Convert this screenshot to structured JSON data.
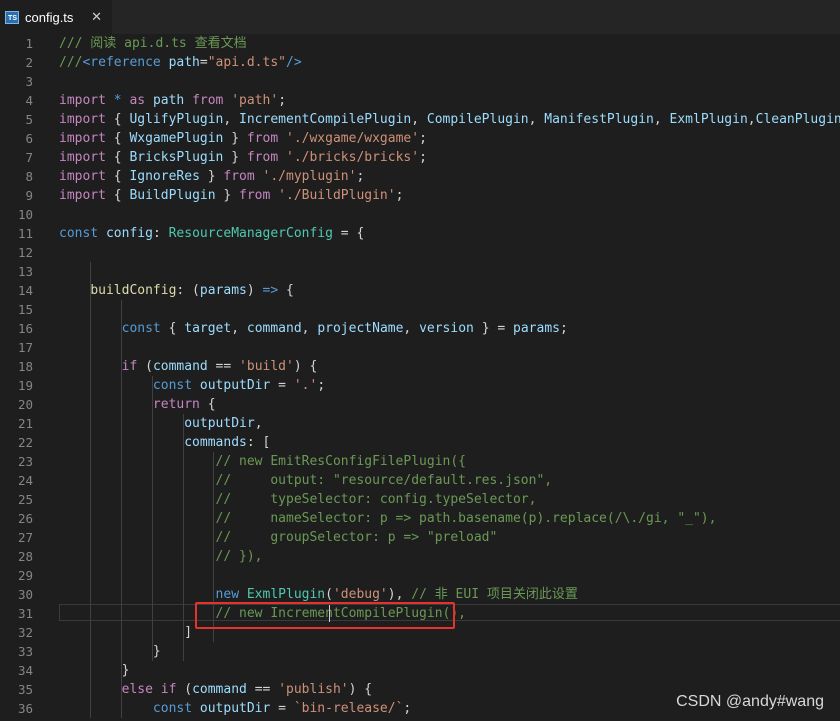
{
  "tab": {
    "filename": "config.ts",
    "icon": "ts-file-icon",
    "close_label": "✕"
  },
  "editor": {
    "lines": [
      {
        "n": "1",
        "tokens": [
          {
            "c": "cm",
            "t": "/// 阅读 api.d.ts 查看文档"
          }
        ]
      },
      {
        "n": "2",
        "tokens": [
          {
            "c": "cm",
            "t": "///"
          },
          {
            "c": "kw",
            "t": "<reference "
          },
          {
            "c": "var",
            "t": "path"
          },
          {
            "c": "pl",
            "t": "="
          },
          {
            "c": "str",
            "t": "\"api.d.ts\""
          },
          {
            "c": "kw",
            "t": "/>"
          }
        ]
      },
      {
        "n": "3",
        "tokens": []
      },
      {
        "n": "4",
        "tokens": [
          {
            "c": "ctl",
            "t": "import"
          },
          {
            "c": "pl",
            "t": " "
          },
          {
            "c": "kw",
            "t": "*"
          },
          {
            "c": "pl",
            "t": " "
          },
          {
            "c": "ctl",
            "t": "as"
          },
          {
            "c": "pl",
            "t": " "
          },
          {
            "c": "var",
            "t": "path"
          },
          {
            "c": "pl",
            "t": " "
          },
          {
            "c": "ctl",
            "t": "from"
          },
          {
            "c": "pl",
            "t": " "
          },
          {
            "c": "str",
            "t": "'path'"
          },
          {
            "c": "pl",
            "t": ";"
          }
        ]
      },
      {
        "n": "5",
        "tokens": [
          {
            "c": "ctl",
            "t": "import"
          },
          {
            "c": "pl",
            "t": " { "
          },
          {
            "c": "var",
            "t": "UglifyPlugin"
          },
          {
            "c": "pl",
            "t": ", "
          },
          {
            "c": "var",
            "t": "IncrementCompilePlugin"
          },
          {
            "c": "pl",
            "t": ", "
          },
          {
            "c": "var",
            "t": "CompilePlugin"
          },
          {
            "c": "pl",
            "t": ", "
          },
          {
            "c": "var",
            "t": "ManifestPlugin"
          },
          {
            "c": "pl",
            "t": ", "
          },
          {
            "c": "var",
            "t": "ExmlPlugin"
          },
          {
            "c": "pl",
            "t": ","
          },
          {
            "c": "var",
            "t": "CleanPlugin"
          },
          {
            "c": "pl",
            "t": ","
          }
        ]
      },
      {
        "n": "6",
        "tokens": [
          {
            "c": "ctl",
            "t": "import"
          },
          {
            "c": "pl",
            "t": " { "
          },
          {
            "c": "var",
            "t": "WxgamePlugin"
          },
          {
            "c": "pl",
            "t": " } "
          },
          {
            "c": "ctl",
            "t": "from"
          },
          {
            "c": "pl",
            "t": " "
          },
          {
            "c": "str",
            "t": "'./wxgame/wxgame'"
          },
          {
            "c": "pl",
            "t": ";"
          }
        ]
      },
      {
        "n": "7",
        "tokens": [
          {
            "c": "ctl",
            "t": "import"
          },
          {
            "c": "pl",
            "t": " { "
          },
          {
            "c": "var",
            "t": "BricksPlugin"
          },
          {
            "c": "pl",
            "t": " } "
          },
          {
            "c": "ctl",
            "t": "from"
          },
          {
            "c": "pl",
            "t": " "
          },
          {
            "c": "str",
            "t": "'./bricks/bricks'"
          },
          {
            "c": "pl",
            "t": ";"
          }
        ]
      },
      {
        "n": "8",
        "tokens": [
          {
            "c": "ctl",
            "t": "import"
          },
          {
            "c": "pl",
            "t": " { "
          },
          {
            "c": "var",
            "t": "IgnoreRes"
          },
          {
            "c": "pl",
            "t": " } "
          },
          {
            "c": "ctl",
            "t": "from"
          },
          {
            "c": "pl",
            "t": " "
          },
          {
            "c": "str",
            "t": "'./myplugin'"
          },
          {
            "c": "pl",
            "t": ";"
          }
        ]
      },
      {
        "n": "9",
        "tokens": [
          {
            "c": "ctl",
            "t": "import"
          },
          {
            "c": "pl",
            "t": " { "
          },
          {
            "c": "var",
            "t": "BuildPlugin"
          },
          {
            "c": "pl",
            "t": " } "
          },
          {
            "c": "ctl",
            "t": "from"
          },
          {
            "c": "pl",
            "t": " "
          },
          {
            "c": "str",
            "t": "'./BuildPlugin'"
          },
          {
            "c": "pl",
            "t": ";"
          }
        ]
      },
      {
        "n": "10",
        "tokens": []
      },
      {
        "n": "11",
        "tokens": [
          {
            "c": "kw",
            "t": "const"
          },
          {
            "c": "pl",
            "t": " "
          },
          {
            "c": "var",
            "t": "config"
          },
          {
            "c": "pl",
            "t": ": "
          },
          {
            "c": "ty",
            "t": "ResourceManagerConfig"
          },
          {
            "c": "pl",
            "t": " = {"
          }
        ]
      },
      {
        "n": "12",
        "tokens": []
      },
      {
        "n": "13",
        "tokens": []
      },
      {
        "n": "14",
        "tokens": [
          {
            "c": "pl",
            "t": "    "
          },
          {
            "c": "fn",
            "t": "buildConfig"
          },
          {
            "c": "pl",
            "t": ": ("
          },
          {
            "c": "var",
            "t": "params"
          },
          {
            "c": "pl",
            "t": ") "
          },
          {
            "c": "kw",
            "t": "=>"
          },
          {
            "c": "pl",
            "t": " {"
          }
        ]
      },
      {
        "n": "15",
        "tokens": []
      },
      {
        "n": "16",
        "tokens": [
          {
            "c": "pl",
            "t": "        "
          },
          {
            "c": "kw",
            "t": "const"
          },
          {
            "c": "pl",
            "t": " { "
          },
          {
            "c": "var",
            "t": "target"
          },
          {
            "c": "pl",
            "t": ", "
          },
          {
            "c": "var",
            "t": "command"
          },
          {
            "c": "pl",
            "t": ", "
          },
          {
            "c": "var",
            "t": "projectName"
          },
          {
            "c": "pl",
            "t": ", "
          },
          {
            "c": "var",
            "t": "version"
          },
          {
            "c": "pl",
            "t": " } = "
          },
          {
            "c": "var",
            "t": "params"
          },
          {
            "c": "pl",
            "t": ";"
          }
        ]
      },
      {
        "n": "17",
        "tokens": []
      },
      {
        "n": "18",
        "tokens": [
          {
            "c": "pl",
            "t": "        "
          },
          {
            "c": "ctl",
            "t": "if"
          },
          {
            "c": "pl",
            "t": " ("
          },
          {
            "c": "var",
            "t": "command"
          },
          {
            "c": "pl",
            "t": " == "
          },
          {
            "c": "str",
            "t": "'build'"
          },
          {
            "c": "pl",
            "t": ") {"
          }
        ]
      },
      {
        "n": "19",
        "tokens": [
          {
            "c": "pl",
            "t": "            "
          },
          {
            "c": "kw",
            "t": "const"
          },
          {
            "c": "pl",
            "t": " "
          },
          {
            "c": "var",
            "t": "outputDir"
          },
          {
            "c": "pl",
            "t": " = "
          },
          {
            "c": "str",
            "t": "'.'"
          },
          {
            "c": "pl",
            "t": ";"
          }
        ]
      },
      {
        "n": "20",
        "tokens": [
          {
            "c": "pl",
            "t": "            "
          },
          {
            "c": "ctl",
            "t": "return"
          },
          {
            "c": "pl",
            "t": " {"
          }
        ]
      },
      {
        "n": "21",
        "tokens": [
          {
            "c": "pl",
            "t": "                "
          },
          {
            "c": "var",
            "t": "outputDir"
          },
          {
            "c": "pl",
            "t": ","
          }
        ]
      },
      {
        "n": "22",
        "tokens": [
          {
            "c": "pl",
            "t": "                "
          },
          {
            "c": "var",
            "t": "commands"
          },
          {
            "c": "pl",
            "t": ": ["
          }
        ]
      },
      {
        "n": "23",
        "tokens": [
          {
            "c": "pl",
            "t": "                    "
          },
          {
            "c": "cm",
            "t": "// new EmitResConfigFilePlugin({"
          }
        ]
      },
      {
        "n": "24",
        "tokens": [
          {
            "c": "pl",
            "t": "                    "
          },
          {
            "c": "cm",
            "t": "//     output: \"resource/default.res.json\","
          }
        ]
      },
      {
        "n": "25",
        "tokens": [
          {
            "c": "pl",
            "t": "                    "
          },
          {
            "c": "cm",
            "t": "//     typeSelector: config.typeSelector,"
          }
        ]
      },
      {
        "n": "26",
        "tokens": [
          {
            "c": "pl",
            "t": "                    "
          },
          {
            "c": "cm",
            "t": "//     nameSelector: p => path.basename(p).replace(/\\./gi, \"_\"),"
          }
        ]
      },
      {
        "n": "27",
        "tokens": [
          {
            "c": "pl",
            "t": "                    "
          },
          {
            "c": "cm",
            "t": "//     groupSelector: p => \"preload\""
          }
        ]
      },
      {
        "n": "28",
        "tokens": [
          {
            "c": "pl",
            "t": "                    "
          },
          {
            "c": "cm",
            "t": "// }),"
          }
        ]
      },
      {
        "n": "29",
        "tokens": []
      },
      {
        "n": "30",
        "tokens": [
          {
            "c": "pl",
            "t": "                    "
          },
          {
            "c": "kw",
            "t": "new"
          },
          {
            "c": "pl",
            "t": " "
          },
          {
            "c": "ty",
            "t": "ExmlPlugin"
          },
          {
            "c": "pl",
            "t": "("
          },
          {
            "c": "str",
            "t": "'debug'"
          },
          {
            "c": "pl",
            "t": "), "
          },
          {
            "c": "cm",
            "t": "// 非 EUI 项目关闭此设置"
          }
        ]
      },
      {
        "n": "31",
        "tokens": [
          {
            "c": "pl",
            "t": "                    "
          },
          {
            "c": "cm",
            "t": "// new IncrementCompilePlugin(),"
          }
        ]
      },
      {
        "n": "32",
        "tokens": [
          {
            "c": "pl",
            "t": "                ]"
          }
        ]
      },
      {
        "n": "33",
        "tokens": [
          {
            "c": "pl",
            "t": "            }"
          }
        ]
      },
      {
        "n": "34",
        "tokens": [
          {
            "c": "pl",
            "t": "        }"
          }
        ]
      },
      {
        "n": "35",
        "tokens": [
          {
            "c": "pl",
            "t": "        "
          },
          {
            "c": "ctl",
            "t": "else"
          },
          {
            "c": "pl",
            "t": " "
          },
          {
            "c": "ctl",
            "t": "if"
          },
          {
            "c": "pl",
            "t": " ("
          },
          {
            "c": "var",
            "t": "command"
          },
          {
            "c": "pl",
            "t": " == "
          },
          {
            "c": "str",
            "t": "'publish'"
          },
          {
            "c": "pl",
            "t": ") {"
          }
        ]
      },
      {
        "n": "36",
        "tokens": [
          {
            "c": "pl",
            "t": "            "
          },
          {
            "c": "kw",
            "t": "const"
          },
          {
            "c": "pl",
            "t": " "
          },
          {
            "c": "var",
            "t": "outputDir"
          },
          {
            "c": "pl",
            "t": " = "
          },
          {
            "c": "str",
            "t": "`bin-release/`"
          },
          {
            "c": "pl",
            "t": ";"
          }
        ]
      }
    ]
  },
  "watermark": "CSDN @andy#wang",
  "colors": {
    "background": "#1e1e1e",
    "keyword": "#569cd6",
    "string": "#ce9178",
    "comment": "#6a9955",
    "type": "#4ec9b0",
    "function": "#dcdcaa",
    "variable": "#9cdcfe",
    "control": "#c586c0",
    "highlight_box": "#e5322d"
  }
}
